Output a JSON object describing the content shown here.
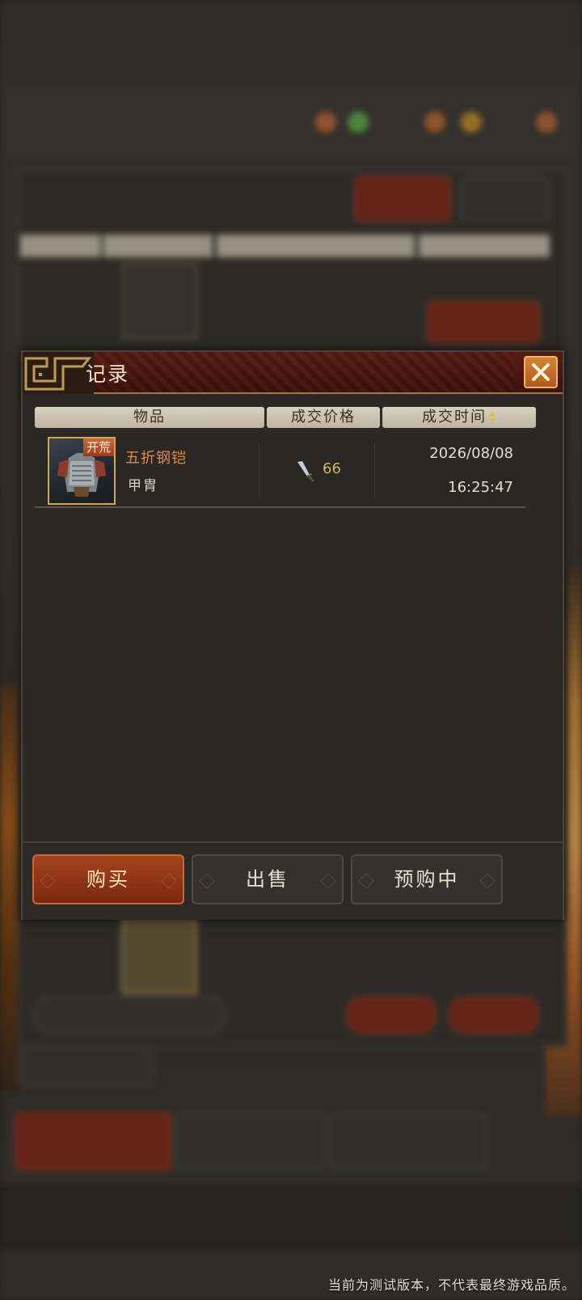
{
  "modal": {
    "title": "记录",
    "columns": {
      "item": "物品",
      "price": "成交价格",
      "time": "成交时间"
    },
    "records": [
      {
        "badge": "开荒",
        "name": "五折钢铠",
        "type": "甲胄",
        "price": "66",
        "price_icon": "dagger-currency-icon",
        "date": "2026/08/08",
        "time": "16:25:47"
      }
    ],
    "buttons": {
      "buy": "购买",
      "sell": "出售",
      "preorder": "预购中"
    }
  },
  "disclaimer": "当前为测试版本，不代表最终游戏品质。",
  "colors": {
    "header_red": "#5a1c14",
    "gold_border": "#d1a64c",
    "item_name": "#e2894a",
    "price": "#d7b15e",
    "buy_button": "#a6441e"
  }
}
